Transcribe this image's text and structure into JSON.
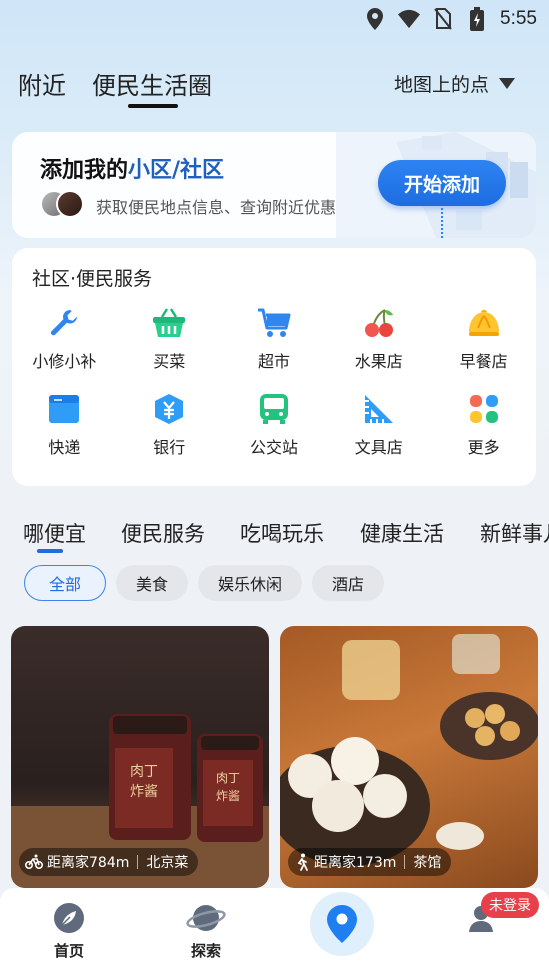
{
  "status_bar": {
    "time": "5:55",
    "icons": [
      "location-icon",
      "wifi-icon",
      "no-sim-icon",
      "battery-charging-icon"
    ]
  },
  "top_nav": {
    "tabs": [
      {
        "label": "附近"
      },
      {
        "label": "便民生活圈"
      }
    ],
    "active_tab": "便民生活圈",
    "map_dropdown": "地图上的点"
  },
  "add_card": {
    "title_prefix": "添加我的",
    "title_highlight": "小区/社区",
    "subtitle": "获取便民地点信息、查询附近优惠",
    "button": "开始添加",
    "accent": "#1d6de0"
  },
  "services": {
    "title": "社区·便民服务",
    "items": [
      {
        "label": "小修小补",
        "icon": "wrench-icon"
      },
      {
        "label": "买菜",
        "icon": "basket-icon"
      },
      {
        "label": "超市",
        "icon": "cart-icon"
      },
      {
        "label": "水果店",
        "icon": "cherry-icon"
      },
      {
        "label": "早餐店",
        "icon": "bun-icon"
      },
      {
        "label": "快递",
        "icon": "package-icon"
      },
      {
        "label": "银行",
        "icon": "bank-icon"
      },
      {
        "label": "公交站",
        "icon": "bus-icon"
      },
      {
        "label": "文具店",
        "icon": "ruler-icon"
      },
      {
        "label": "更多",
        "icon": "more-grid-icon"
      }
    ]
  },
  "category_tabs": {
    "items": [
      "哪便宜",
      "便民服务",
      "吃喝玩乐",
      "健康生活",
      "新鲜事儿"
    ],
    "active": "哪便宜"
  },
  "filters": {
    "items": [
      "全部",
      "美食",
      "娱乐休闲",
      "酒店"
    ],
    "active": "全部"
  },
  "feed": [
    {
      "distance": "距离家784m",
      "category": "北京菜",
      "icon": "bike-icon",
      "image": "jar-sauce-image"
    },
    {
      "distance": "距离家173m",
      "category": "茶馆",
      "icon": "walk-icon",
      "image": "teahouse-image"
    }
  ],
  "bottom_nav": {
    "items": [
      {
        "label": "首页",
        "icon": "leaf-icon"
      },
      {
        "label": "探索",
        "icon": "planet-icon"
      }
    ],
    "center_icon": "map-pin-icon",
    "login_badge": "未登录"
  }
}
